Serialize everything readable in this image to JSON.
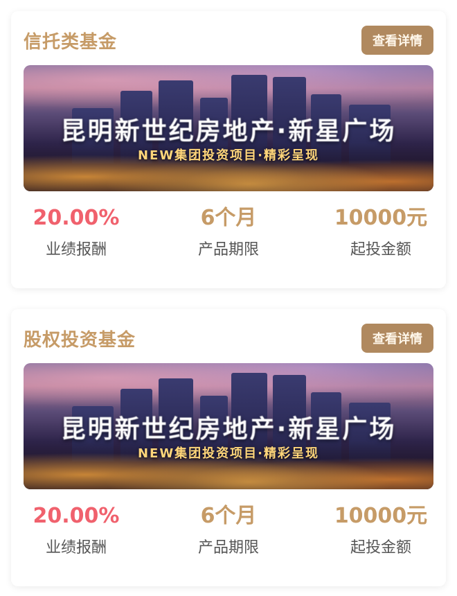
{
  "cards": [
    {
      "title": "信托类基金",
      "badge": "查看详情",
      "banner_title": "昆明新世纪房地产·新星广场",
      "banner_subtitle": "NEW集团投资项目·精彩呈现",
      "stats": [
        {
          "value": "20.00%",
          "label": "业绩报酬",
          "color": "#f0616d"
        },
        {
          "value": "6个月",
          "label": "产品期限",
          "color": "#c69b67"
        },
        {
          "value": "10000元",
          "label": "起投金额",
          "color": "#c69b67"
        }
      ]
    },
    {
      "title": "股权投资基金",
      "badge": "查看详情",
      "banner_title": "昆明新世纪房地产·新星广场",
      "banner_subtitle": "NEW集团投资项目·精彩呈现",
      "stats": [
        {
          "value": "20.00%",
          "label": "业绩报酬",
          "color": "#f0616d"
        },
        {
          "value": "6个月",
          "label": "产品期限",
          "color": "#c69b67"
        },
        {
          "value": "10000元",
          "label": "起投金额",
          "color": "#c69b67"
        }
      ]
    }
  ],
  "colors": {
    "accent_gold": "#c69b67",
    "badge_bg": "#b0895f",
    "highlight_red": "#f0616d"
  }
}
